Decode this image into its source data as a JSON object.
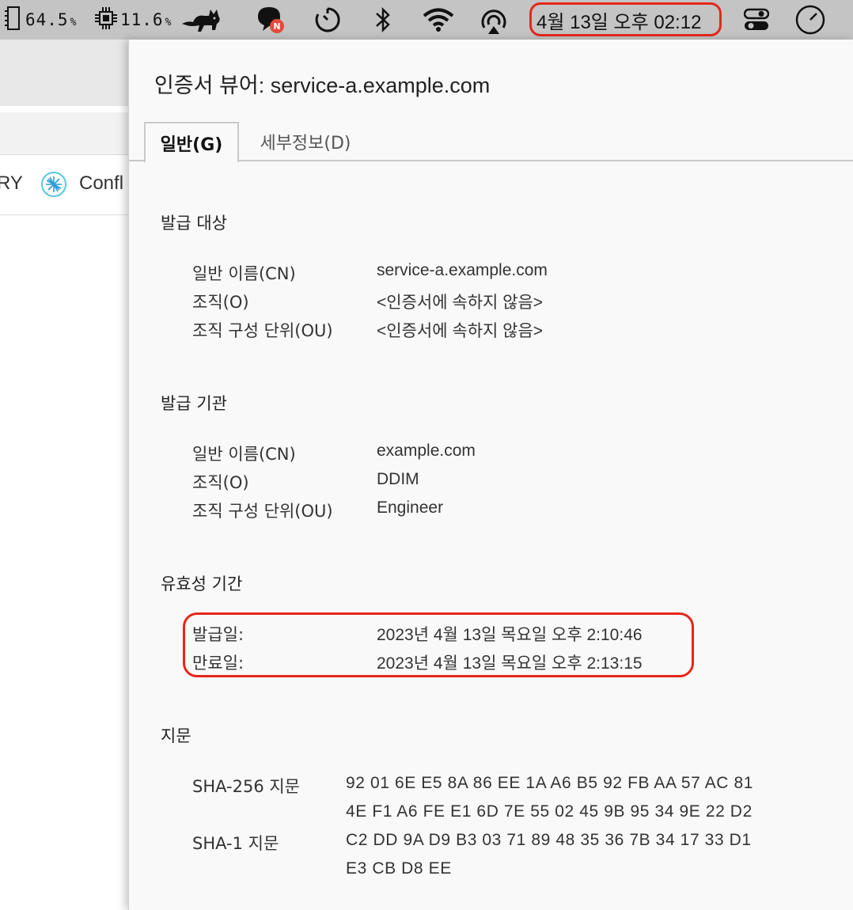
{
  "menubar": {
    "memory": {
      "value": "64.5",
      "unit": "%",
      "icon": "memory-chip-icon"
    },
    "cpu": {
      "value": "11.6",
      "unit": "%",
      "icon": "cpu-chip-icon"
    },
    "icons": [
      "runcat-cat-icon",
      "chat-bubble-icon",
      "timer-icon",
      "bluetooth-icon",
      "wifi-icon",
      "airplay-audio-icon",
      "control-center-icon",
      "clock-icon"
    ],
    "datetime": "4월 13일 오후 02:12",
    "highlight_color": "#e5271b"
  },
  "browser": {
    "bookmarks": [
      {
        "label": "RY"
      },
      {
        "label": "Confl",
        "icon": "confluence-icon"
      }
    ]
  },
  "dialog": {
    "title": "인증서 뷰어: service-a.example.com",
    "tabs": [
      {
        "label": "일반(G)",
        "active": true
      },
      {
        "label": "세부정보(D)",
        "active": false
      }
    ],
    "issued_to": {
      "heading": "발급 대상",
      "rows": [
        {
          "label": "일반 이름(CN)",
          "value": "service-a.example.com"
        },
        {
          "label": "조직(O)",
          "value": "<인증서에 속하지 않음>"
        },
        {
          "label": "조직 구성 단위(OU)",
          "value": "<인증서에 속하지 않음>"
        }
      ]
    },
    "issued_by": {
      "heading": "발급 기관",
      "rows": [
        {
          "label": "일반 이름(CN)",
          "value": "example.com"
        },
        {
          "label": "조직(O)",
          "value": "DDIM"
        },
        {
          "label": "조직 구성 단위(OU)",
          "value": "Engineer"
        }
      ]
    },
    "validity": {
      "heading": "유효성 기간",
      "rows": [
        {
          "label": "발급일:",
          "value": "2023년 4월 13일 목요일 오후 2:10:46"
        },
        {
          "label": "만료일:",
          "value": "2023년 4월 13일 목요일 오후 2:13:15"
        }
      ]
    },
    "fingerprints": {
      "heading": "지문",
      "sha256": {
        "label": "SHA-256 지문",
        "line1": "92 01 6E E5 8A 86 EE 1A A6 B5 92 FB AA 57 AC 81",
        "line2": "4E F1 A6 FE E1 6D 7E 55 02 45 9B 95 34 9E 22 D2"
      },
      "sha1": {
        "label": "SHA-1 지문",
        "line1": "C2 DD 9A D9 B3 03 71 89 48 35 36 7B 34 17 33 D1",
        "line2": "E3 CB D8 EE"
      }
    }
  }
}
